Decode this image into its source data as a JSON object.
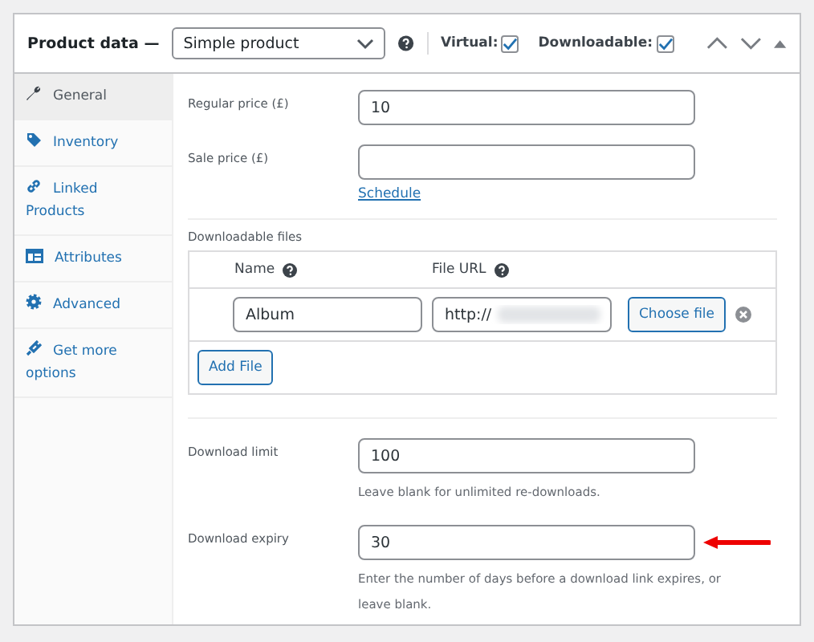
{
  "header": {
    "title": "Product data —",
    "product_type": "Simple product",
    "options": [
      {
        "label": "Virtual:",
        "checked": true
      },
      {
        "label": "Downloadable:",
        "checked": true
      }
    ]
  },
  "tabs": [
    {
      "label": "General",
      "selected": true
    },
    {
      "label": "Inventory",
      "selected": false
    },
    {
      "label": "Linked Products",
      "selected": false
    },
    {
      "label": "Attributes",
      "selected": false
    },
    {
      "label": "Advanced",
      "selected": false
    },
    {
      "label": "Get more options",
      "selected": false
    }
  ],
  "prices": [
    {
      "label": "Regular price (£)",
      "value": "10"
    },
    {
      "label": "Sale price (£)",
      "link": "Schedule"
    }
  ],
  "downloadable_files": {
    "label": "Downloadable files",
    "columns": [
      "Name",
      "File URL"
    ],
    "rows": [
      {
        "name": "Album",
        "url": "http://",
        "button": "Choose file"
      }
    ],
    "add_button": "Add File"
  },
  "download_fields": [
    {
      "label": "Download limit",
      "value": "100",
      "hint": "Leave blank for unlimited re-downloads.",
      "arrow": false
    },
    {
      "label": "Download expiry",
      "value": "30",
      "hint": "Enter the number of days before a download link expires, or leave blank.",
      "arrow": true
    }
  ]
}
